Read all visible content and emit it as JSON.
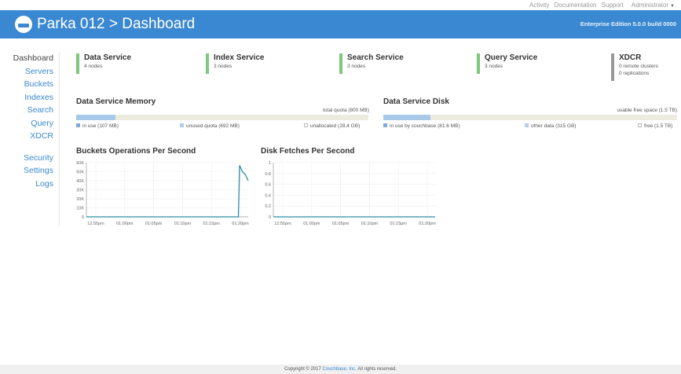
{
  "topbar": {
    "links": [
      "Activity",
      "Documentation",
      "Support",
      "Administrator"
    ]
  },
  "header": {
    "title": "Parka 012 > Dashboard",
    "edition": "Enterprise Edition 5.0.0 build 0000"
  },
  "nav": {
    "items": [
      "Dashboard",
      "Servers",
      "Buckets",
      "Indexes",
      "Search",
      "Query",
      "XDCR",
      "Security",
      "Settings",
      "Logs"
    ],
    "active": "Dashboard"
  },
  "services": [
    {
      "name": "Data Service",
      "sub": "4 nodes",
      "status": "green"
    },
    {
      "name": "Index Service",
      "sub": "3 nodes",
      "status": "green"
    },
    {
      "name": "Search Service",
      "sub": "3 nodes",
      "status": "green"
    },
    {
      "name": "Query Service",
      "sub": "3 nodes",
      "status": "green"
    },
    {
      "name": "XDCR",
      "sub": "0 remote clusters",
      "sub2": "0 replications",
      "status": "gray"
    }
  ],
  "memory": {
    "title": "Data Service Memory",
    "quota_label": "total quota (800 MB)",
    "fill_fraction": 0.134,
    "legend": [
      "in use (107 MB)",
      "unused quota (692 MB)",
      "unallocated (28.4 GB)"
    ]
  },
  "disk": {
    "title": "Data Service Disk",
    "quota_label": "usable free space (1.5 TB)",
    "fill_fraction": 0.16,
    "legend": [
      "in use by couchbase (81.6 MB)",
      "other data (315 GB)",
      "free (1.5 TB)"
    ]
  },
  "colors": {
    "brand": "#3a88d1",
    "service_ok": "#7cc87c",
    "service_off": "#999999",
    "series": "#2a8fa3"
  },
  "charts": {
    "ops": {
      "title": "Buckets Operations Per Second"
    },
    "disk": {
      "title": "Disk Fetches Per Second"
    }
  },
  "chart_data": [
    {
      "type": "line",
      "title": "Buckets Operations Per Second",
      "xlabel": "",
      "ylabel": "",
      "x_ticks": [
        "12:55pm",
        "01:00pm",
        "01:05pm",
        "01:10pm",
        "01:15pm",
        "01:20pm"
      ],
      "y_ticks": [
        "0",
        "10K",
        "20K",
        "30K",
        "40K",
        "50K",
        "60K"
      ],
      "ylim": [
        0,
        60000
      ],
      "xlim": [
        0,
        28
      ],
      "series": [
        {
          "x": [
            0,
            3,
            9,
            15,
            21,
            26.3,
            26.5,
            27,
            27.5,
            28
          ],
          "y": [
            0,
            0,
            0,
            0,
            0,
            0,
            57000,
            50000,
            47000,
            40000
          ]
        }
      ]
    },
    {
      "type": "line",
      "title": "Disk Fetches Per Second",
      "xlabel": "",
      "ylabel": "",
      "x_ticks": [
        "12:55pm",
        "01:00pm",
        "01:05pm",
        "01:10pm",
        "01:15pm",
        "01:20pm"
      ],
      "y_ticks": [
        "0",
        "0.2",
        "0.4",
        "0.6",
        "0.8",
        "1"
      ],
      "ylim": [
        0,
        1
      ],
      "xlim": [
        0,
        28
      ],
      "series": [
        {
          "x": [
            0,
            28
          ],
          "y": [
            0,
            0
          ]
        }
      ]
    }
  ],
  "footer": {
    "prefix": "Copyright © 2017",
    "link": "Couchbase, Inc.",
    "suffix": "All rights reserved."
  }
}
